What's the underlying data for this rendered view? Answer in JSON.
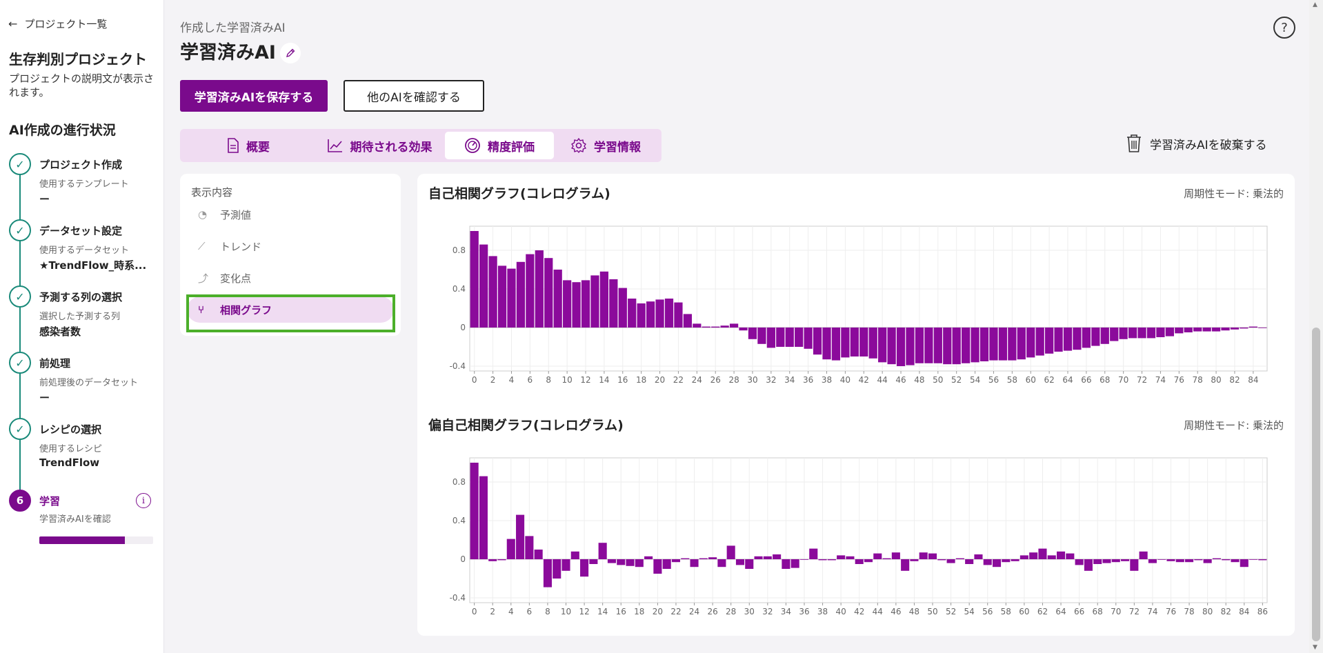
{
  "sidebar": {
    "back_label": "プロジェクト一覧",
    "project_title": "生存判別プロジェクト",
    "project_desc": "プロジェクトの説明文が表示されます。",
    "progress_title": "AI作成の進行状況",
    "steps": [
      {
        "name": "プロジェクト作成",
        "sub": "使用するテンプレート",
        "value": "ー"
      },
      {
        "name": "データセット設定",
        "sub": "使用するデータセット",
        "value": "★TrendFlow_時系..."
      },
      {
        "name": "予測する列の選択",
        "sub": "選択した予測する列",
        "value": "感染者数"
      },
      {
        "name": "前処理",
        "sub": "前処理後のデータセット",
        "value": "ー"
      },
      {
        "name": "レシピの選択",
        "sub": "使用するレシピ",
        "value": "TrendFlow"
      },
      {
        "number": "6",
        "name": "学習",
        "sub": "学習済みAIを確認",
        "progress": 0.75
      }
    ]
  },
  "header": {
    "breadcrumb": "作成した学習済みAI",
    "title": "学習済みAI",
    "save_label": "学習済みAIを保存する",
    "other_label": "他のAIを確認する",
    "help_label": "?",
    "discard_label": "学習済みAIを破棄する"
  },
  "tabs": [
    {
      "label": "概要",
      "icon": "document-icon",
      "active": false
    },
    {
      "label": "期待される効果",
      "icon": "line-chart-icon",
      "active": false
    },
    {
      "label": "精度評価",
      "icon": "gauge-icon",
      "active": true
    },
    {
      "label": "学習情報",
      "icon": "gear-icon",
      "active": false
    }
  ],
  "display": {
    "title": "表示内容",
    "items": [
      {
        "label": "予測値",
        "icon": "forecast-icon",
        "active": false
      },
      {
        "label": "トレンド",
        "icon": "trend-icon",
        "active": false
      },
      {
        "label": "変化点",
        "icon": "changepoint-icon",
        "active": false
      },
      {
        "label": "相関グラフ",
        "icon": "correlation-icon",
        "active": true
      }
    ]
  },
  "chart_data": [
    {
      "type": "bar",
      "title": "自己相関グラフ(コレログラム)",
      "mode": "周期性モード: 乗法的",
      "ylim": [
        -0.45,
        1.05
      ],
      "yticks": [
        -0.4,
        0,
        0.4,
        0.8
      ],
      "xtick_step": 2,
      "xmax_tick": 84,
      "grid": true,
      "color": "#8b0a9b",
      "x": [
        0,
        1,
        2,
        3,
        4,
        5,
        6,
        7,
        8,
        9,
        10,
        11,
        12,
        13,
        14,
        15,
        16,
        17,
        18,
        19,
        20,
        21,
        22,
        23,
        24,
        25,
        26,
        27,
        28,
        29,
        30,
        31,
        32,
        33,
        34,
        35,
        36,
        37,
        38,
        39,
        40,
        41,
        42,
        43,
        44,
        45,
        46,
        47,
        48,
        49,
        50,
        51,
        52,
        53,
        54,
        55,
        56,
        57,
        58,
        59,
        60,
        61,
        62,
        63,
        64,
        65,
        66,
        67,
        68,
        69,
        70,
        71,
        72,
        73,
        74,
        75,
        76,
        77,
        78,
        79,
        80,
        81,
        82,
        83,
        84,
        85
      ],
      "values": [
        1.0,
        0.86,
        0.74,
        0.64,
        0.61,
        0.68,
        0.76,
        0.8,
        0.72,
        0.6,
        0.49,
        0.47,
        0.49,
        0.54,
        0.58,
        0.5,
        0.41,
        0.3,
        0.25,
        0.27,
        0.29,
        0.3,
        0.26,
        0.14,
        0.04,
        0.01,
        0.01,
        0.02,
        0.04,
        -0.03,
        -0.12,
        -0.17,
        -0.21,
        -0.2,
        -0.2,
        -0.2,
        -0.22,
        -0.28,
        -0.33,
        -0.34,
        -0.31,
        -0.3,
        -0.3,
        -0.32,
        -0.36,
        -0.38,
        -0.4,
        -0.39,
        -0.37,
        -0.37,
        -0.37,
        -0.38,
        -0.38,
        -0.37,
        -0.36,
        -0.35,
        -0.34,
        -0.34,
        -0.34,
        -0.33,
        -0.31,
        -0.29,
        -0.27,
        -0.25,
        -0.24,
        -0.23,
        -0.21,
        -0.19,
        -0.17,
        -0.14,
        -0.12,
        -0.11,
        -0.11,
        -0.11,
        -0.1,
        -0.09,
        -0.06,
        -0.05,
        -0.04,
        -0.04,
        -0.04,
        -0.03,
        -0.02,
        -0.01,
        0.01,
        0.0
      ]
    },
    {
      "type": "bar",
      "title": "偏自己相関グラフ(コレログラム)",
      "mode": "周期性モード: 乗法的",
      "ylim": [
        -0.45,
        1.05
      ],
      "yticks": [
        -0.4,
        0,
        0.4,
        0.8
      ],
      "xtick_step": 2,
      "xmax_tick": 86,
      "grid": true,
      "color": "#8b0a9b",
      "x": [
        0,
        1,
        2,
        3,
        4,
        5,
        6,
        7,
        8,
        9,
        10,
        11,
        12,
        13,
        14,
        15,
        16,
        17,
        18,
        19,
        20,
        21,
        22,
        23,
        24,
        25,
        26,
        27,
        28,
        29,
        30,
        31,
        32,
        33,
        34,
        35,
        36,
        37,
        38,
        39,
        40,
        41,
        42,
        43,
        44,
        45,
        46,
        47,
        48,
        49,
        50,
        51,
        52,
        53,
        54,
        55,
        56,
        57,
        58,
        59,
        60,
        61,
        62,
        63,
        64,
        65,
        66,
        67,
        68,
        69,
        70,
        71,
        72,
        73,
        74,
        75,
        76,
        77,
        78,
        79,
        80,
        81,
        82,
        83,
        84,
        85,
        86
      ],
      "values": [
        1.0,
        0.86,
        -0.02,
        -0.01,
        0.21,
        0.46,
        0.24,
        0.1,
        -0.29,
        -0.2,
        -0.12,
        0.08,
        -0.18,
        -0.05,
        0.17,
        -0.04,
        -0.06,
        -0.07,
        -0.08,
        0.03,
        -0.15,
        -0.1,
        -0.03,
        0.01,
        -0.08,
        0.01,
        0.02,
        -0.08,
        0.14,
        -0.06,
        -0.1,
        0.03,
        0.03,
        0.05,
        -0.1,
        -0.09,
        0.0,
        0.11,
        -0.01,
        -0.01,
        0.04,
        0.03,
        -0.05,
        -0.03,
        0.06,
        0.01,
        0.07,
        -0.12,
        -0.02,
        0.07,
        0.06,
        -0.01,
        -0.04,
        0.01,
        -0.05,
        0.05,
        -0.06,
        -0.08,
        -0.03,
        -0.02,
        0.04,
        0.07,
        0.11,
        0.04,
        0.08,
        0.06,
        -0.06,
        -0.12,
        -0.05,
        -0.04,
        -0.03,
        -0.02,
        -0.12,
        0.08,
        -0.04,
        0.0,
        -0.02,
        -0.03,
        -0.03,
        -0.01,
        -0.04,
        0.01,
        -0.01,
        -0.03,
        -0.08,
        0.0,
        -0.01
      ]
    }
  ]
}
